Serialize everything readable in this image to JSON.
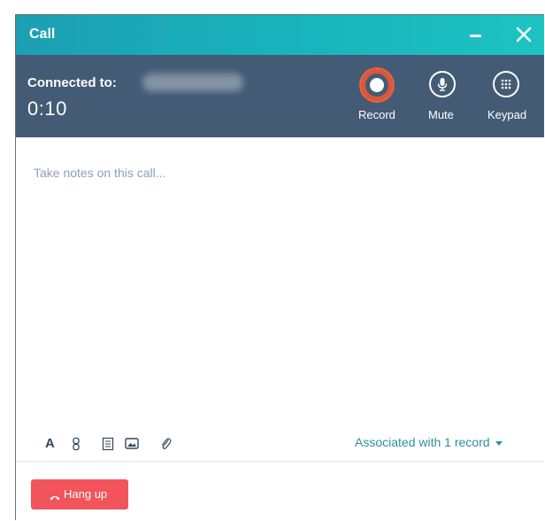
{
  "window": {
    "title": "Call"
  },
  "call": {
    "connected_label": "Connected to:",
    "timer": "0:10"
  },
  "controls": {
    "record_label": "Record",
    "mute_label": "Mute",
    "keypad_label": "Keypad"
  },
  "notes": {
    "placeholder": "Take notes on this call..."
  },
  "toolbar": {
    "bold_label": "A",
    "associated_label": "Associated with 1 record"
  },
  "footer": {
    "hangup_label": "Hang up"
  },
  "colors": {
    "titlebar": "#17b7be",
    "statusbar": "#445b75",
    "record_highlight": "#e8623f",
    "hangup": "#f2545b",
    "link": "#2d8fa3"
  },
  "icons": [
    "minimize-icon",
    "close-icon",
    "record-icon",
    "microphone-icon",
    "keypad-icon",
    "bold-icon",
    "link-icon",
    "list-icon",
    "image-icon",
    "attachment-icon",
    "chevron-down-icon",
    "phone-hangup-icon"
  ]
}
